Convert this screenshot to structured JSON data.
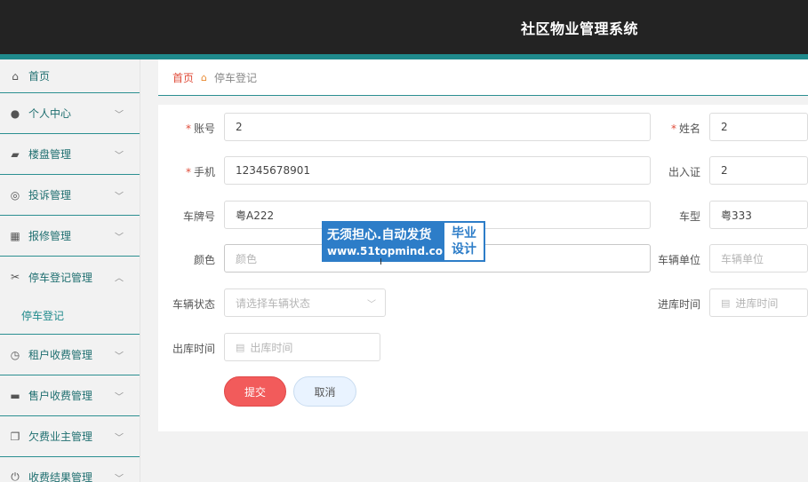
{
  "app": {
    "title": "社区物业管理系统"
  },
  "sidebar": {
    "items": [
      {
        "label": "首页",
        "icon": "home-icon",
        "glyph": "⌂"
      },
      {
        "label": "个人中心",
        "icon": "user-icon",
        "glyph": "●"
      },
      {
        "label": "楼盘管理",
        "icon": "building-icon",
        "glyph": "▰"
      },
      {
        "label": "投诉管理",
        "icon": "lifebuoy-icon",
        "glyph": "◎"
      },
      {
        "label": "报修管理",
        "icon": "grid-icon",
        "glyph": "▦"
      },
      {
        "label": "停车登记管理",
        "icon": "ticket-icon",
        "glyph": "✂"
      },
      {
        "label": "租户收费管理",
        "icon": "clock-icon",
        "glyph": "◷"
      },
      {
        "label": "售户收费管理",
        "icon": "printer-icon",
        "glyph": "▬"
      },
      {
        "label": "欠费业主管理",
        "icon": "copy-icon",
        "glyph": "❐"
      },
      {
        "label": "收费结果管理",
        "icon": "power-icon",
        "glyph": "⏻"
      }
    ],
    "submenu_parking": "停车登记",
    "chevron_down": "﹀",
    "chevron_up": "︿"
  },
  "breadcrumb": {
    "home": "首页",
    "separator": "⌂",
    "current": "停车登记"
  },
  "form": {
    "account_label": "账号",
    "account_value": "2",
    "name_label": "姓名",
    "name_value": "2",
    "phone_label": "手机",
    "phone_value": "12345678901",
    "pass_label": "出入证",
    "pass_value": "2",
    "plate_label": "车牌号",
    "plate_value": "粤A222",
    "model_label": "车型",
    "model_value": "粤333",
    "color_label": "颜色",
    "color_placeholder": "颜色",
    "unit_label": "车辆单位",
    "unit_placeholder": "车辆单位",
    "status_label": "车辆状态",
    "status_placeholder": "请选择车辆状态",
    "in_time_label": "进库时间",
    "in_time_placeholder": "进库时间",
    "out_time_label": "出库时间",
    "out_time_placeholder": "出库时间",
    "required_mark": "*",
    "calendar_glyph": "▤",
    "dropdown_glyph": "﹀"
  },
  "buttons": {
    "submit": "提交",
    "cancel": "取消"
  },
  "watermark": {
    "line1": "无须担心.自动发货",
    "line2": "www.51topmind.com",
    "badge1": "毕业",
    "badge2": "设计"
  },
  "colors": {
    "accent": "#1f8a8c",
    "danger": "#f25b5b",
    "topbar": "#232323",
    "watermark": "#2d7dc8"
  }
}
